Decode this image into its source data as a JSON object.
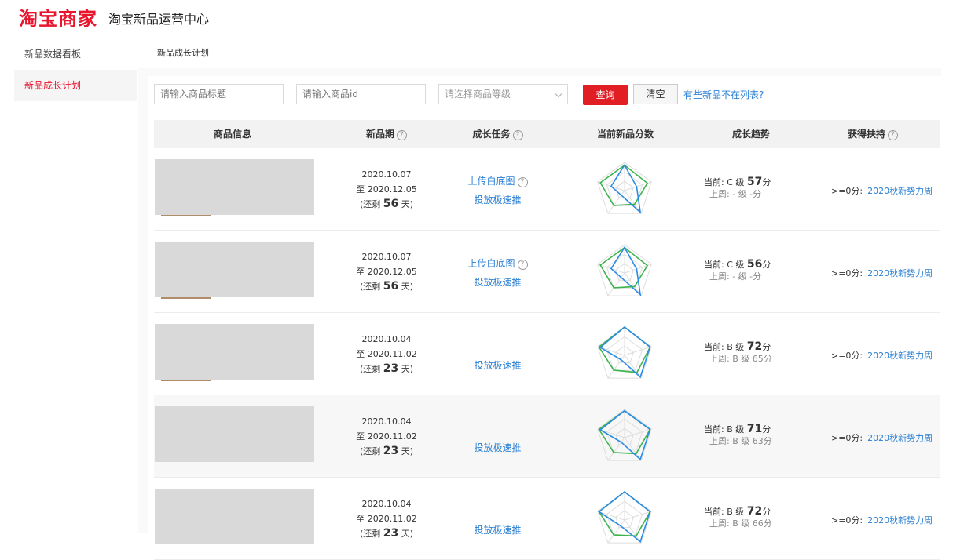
{
  "header": {
    "logo": "淘宝商家",
    "subtitle": "淘宝新品运营中心"
  },
  "sidebar": {
    "items": [
      {
        "label": "新品数据看板"
      },
      {
        "label": "新品成长计划"
      }
    ]
  },
  "breadcrumb": "新品成长计划",
  "filters": {
    "title_placeholder": "请输入商品标题",
    "id_placeholder": "请输入商品id",
    "grade_placeholder": "请选择商品等级",
    "query_label": "查询",
    "clear_label": "清空",
    "missing_link": "有些新品不在列表?"
  },
  "table": {
    "columns": [
      "商品信息",
      "新品期",
      "成长任务",
      "当前新品分数",
      "成长趋势",
      "获得扶持"
    ],
    "qmark": "?",
    "rows": [
      {
        "start": "2020.10.07",
        "end": "至 2020.12.05",
        "remain_prefix": "(还剩",
        "remain_days": "56",
        "remain_suffix": "天)",
        "task_upload": "上传白底图",
        "task_push": "投放极速推",
        "now_label": "当前: C 级",
        "now_score": "57",
        "now_unit": "分",
        "prev": "上周: - 级 -分",
        "support_rule": ">=0分:",
        "support_link": "2020秋新势力周"
      },
      {
        "start": "2020.10.07",
        "end": "至 2020.12.05",
        "remain_prefix": "(还剩",
        "remain_days": "56",
        "remain_suffix": "天)",
        "task_upload": "上传白底图",
        "task_push": "投放极速推",
        "now_label": "当前: C 级",
        "now_score": "56",
        "now_unit": "分",
        "prev": "上周: - 级 -分",
        "support_rule": ">=0分:",
        "support_link": "2020秋新势力周"
      },
      {
        "start": "2020.10.04",
        "end": "至 2020.11.02",
        "remain_prefix": "(还剩",
        "remain_days": "23",
        "remain_suffix": "天)",
        "task_upload": "",
        "task_push": "投放极速推",
        "now_label": "当前: B 级",
        "now_score": "72",
        "now_unit": "分",
        "prev": "上周: B 级 65分",
        "support_rule": ">=0分:",
        "support_link": "2020秋新势力周"
      },
      {
        "start": "2020.10.04",
        "end": "至 2020.11.02",
        "remain_prefix": "(还剩",
        "remain_days": "23",
        "remain_suffix": "天)",
        "task_upload": "",
        "task_push": "投放极速推",
        "now_label": "当前: B 级",
        "now_score": "71",
        "now_unit": "分",
        "prev": "上周: B 级 63分",
        "support_rule": ">=0分:",
        "support_link": "2020秋新势力周"
      },
      {
        "start": "2020.10.04",
        "end": "至 2020.11.02",
        "remain_prefix": "(还剩",
        "remain_days": "23",
        "remain_suffix": "天)",
        "task_upload": "",
        "task_push": "投放极速推",
        "now_label": "当前: B 级",
        "now_score": "72",
        "now_unit": "分",
        "prev": "上周: B 级 66分",
        "support_rule": ">=0分:",
        "support_link": "2020秋新势力周"
      }
    ]
  },
  "radar": {
    "colors": {
      "current": "#2b8ce6",
      "previous": "#3cb44b",
      "grid": "#dddddd"
    },
    "rows": [
      {
        "current": [
          0.9,
          0.45,
          0.95,
          0.2,
          0.5
        ],
        "previous": [
          0.9,
          0.85,
          0.6,
          0.65,
          0.9
        ]
      },
      {
        "current": [
          0.9,
          0.45,
          0.95,
          0.2,
          0.5
        ],
        "previous": [
          0.9,
          0.85,
          0.6,
          0.65,
          0.9
        ]
      },
      {
        "current": [
          1.0,
          0.95,
          0.95,
          0.2,
          0.9
        ],
        "previous": [
          1.0,
          0.95,
          0.75,
          0.65,
          0.95
        ]
      },
      {
        "current": [
          0.95,
          0.95,
          0.95,
          0.2,
          0.9
        ],
        "previous": [
          0.95,
          0.95,
          0.7,
          0.65,
          0.95
        ]
      },
      {
        "current": [
          1.0,
          0.95,
          0.95,
          0.25,
          0.95
        ],
        "previous": [
          1.0,
          0.95,
          0.7,
          0.65,
          0.95
        ]
      }
    ]
  }
}
